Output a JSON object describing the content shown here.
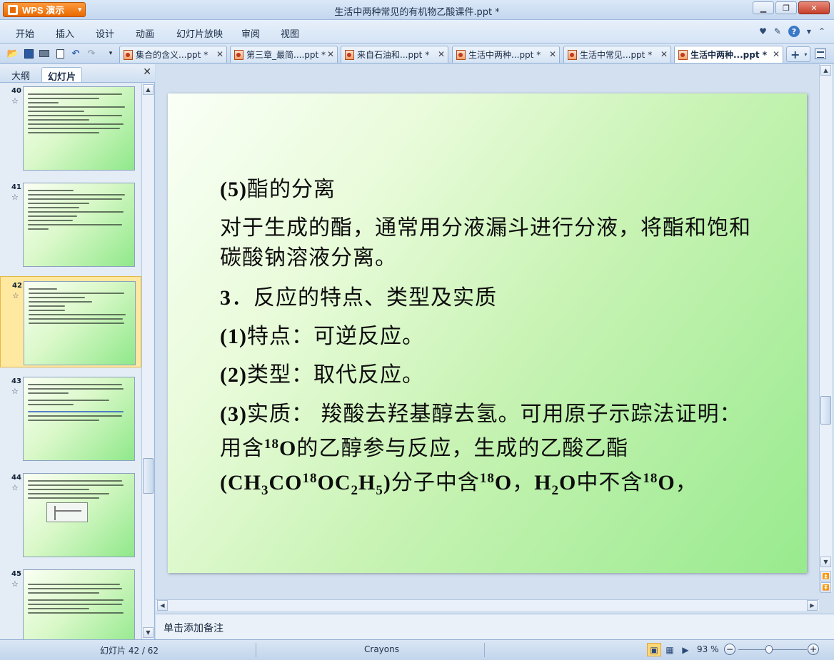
{
  "app": {
    "button_label": "WPS 演示",
    "window_title": "生活中两种常见的有机物乙酸课件.ppt *"
  },
  "menu": [
    "开始",
    "插入",
    "设计",
    "动画",
    "幻灯片放映",
    "审阅",
    "视图"
  ],
  "tabs": [
    {
      "label": "集合的含义...ppt *",
      "active": false
    },
    {
      "label": "第三章_最简....ppt *",
      "active": false
    },
    {
      "label": "来自石油和...ppt *",
      "active": false
    },
    {
      "label": "生活中两种...ppt *",
      "active": false
    },
    {
      "label": "生活中常见...ppt *",
      "active": false
    },
    {
      "label": "生活中两种...ppt *",
      "active": true
    }
  ],
  "panel": {
    "tab_outline": "大纲",
    "tab_slides": "幻灯片"
  },
  "thumbnails": [
    {
      "num": "40",
      "selected": false
    },
    {
      "num": "41",
      "selected": false
    },
    {
      "num": "42",
      "selected": true
    },
    {
      "num": "43",
      "selected": false
    },
    {
      "num": "44",
      "selected": false
    },
    {
      "num": "45",
      "selected": false
    }
  ],
  "slide": {
    "heading_num": "(5)",
    "heading_text": "酯的分离",
    "para1": "对于生成的酯，通常用分液漏斗进行分液，将酯和饱和碳酸钠溶液分离。",
    "h2_num": "3",
    "h2_text": "．反应的特点、类型及实质",
    "p1_num": "(1)",
    "p1_text": "特点：可逆反应。",
    "p2_num": "(2)",
    "p2_text": "类型：取代反应。",
    "p3_num": "(3)",
    "p3_text_a": "实质： 羧酸去羟基醇去氢。可用原子示踪法证明：用含",
    "isotope": "18",
    "oxygen": "O",
    "p3_text_b": "的乙醇参与反应，生成的乙酸乙酯",
    "formula_a": "(CH",
    "sub3": "3",
    "formula_b": "CO",
    "formula_c": "OC",
    "sub2": "2",
    "formula_d": "H",
    "sub5": "5",
    "formula_e": ")",
    "p3_text_c": "分子中含",
    "p3_text_d": "，",
    "water_h": "H",
    "water_o": "O",
    "p3_text_e": "中不含",
    "p3_text_f": "，"
  },
  "notes": {
    "placeholder": "单击添加备注"
  },
  "status": {
    "slide_indicator": "幻灯片 42 / 62",
    "theme": "Crayons",
    "zoom": "93 %"
  }
}
